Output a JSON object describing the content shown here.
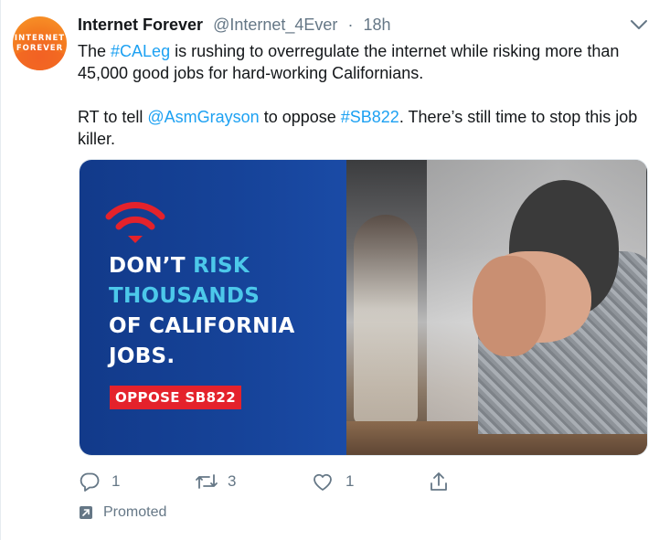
{
  "tweet": {
    "avatar": {
      "line1": "INTERNET",
      "line2": "FOREVER"
    },
    "author_name": "Internet Forever",
    "handle": "@Internet_4Ever",
    "separator": "·",
    "time": "18h",
    "text": {
      "p1_prefix": "The ",
      "p1_hashtag": "#CALeg",
      "p1_suffix": " is rushing to overregulate the internet while risking more than 45,000 good jobs for hard-working Californians.",
      "p2_prefix": "RT to tell ",
      "p2_mention": "@AsmGrayson",
      "p2_middle": " to oppose ",
      "p2_hashtag": "#SB822",
      "p2_suffix": ". There’s still time to stop this job killer."
    },
    "media": {
      "headline_w1": "DON’T ",
      "headline_w2": "RISK",
      "headline_l2": "THOUSANDS",
      "headline_l3": "OF CALIFORNIA",
      "headline_l4": "JOBS.",
      "badge": "OPPOSE SB822",
      "colors": {
        "blue": "#164399",
        "accent": "#4cc8ea",
        "red": "#e4222b"
      }
    },
    "actions": {
      "reply_count": "1",
      "retweet_count": "3",
      "like_count": "1"
    },
    "promoted_label": "Promoted",
    "icons": [
      "chevron-down-icon",
      "reply-icon",
      "retweet-icon",
      "like-icon",
      "share-icon",
      "promoted-icon",
      "wifi-icon"
    ]
  }
}
